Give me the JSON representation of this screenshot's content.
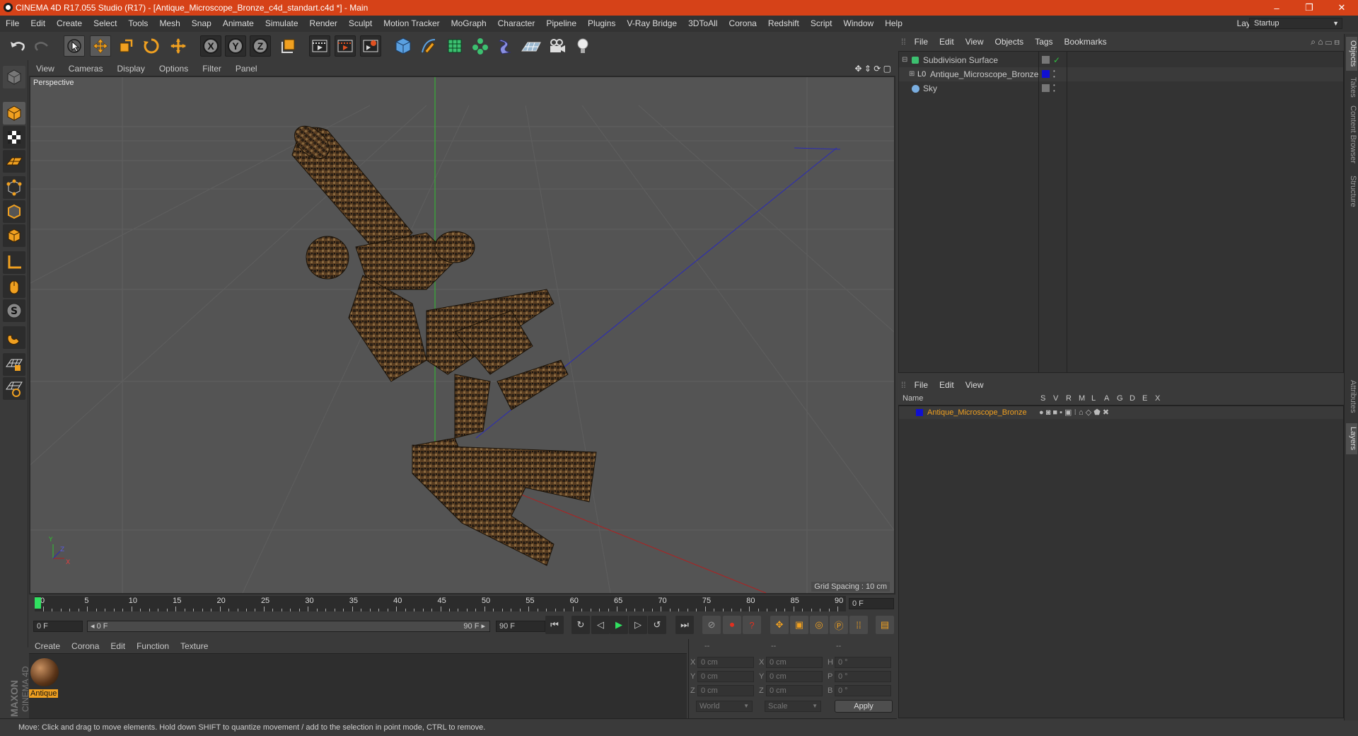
{
  "window": {
    "title": "CINEMA 4D R17.055 Studio (R17) - [Antique_Microscope_Bronze_c4d_standart.c4d *] - Main",
    "controls": [
      "–",
      "❐",
      "✕"
    ]
  },
  "menubar": {
    "items": [
      "File",
      "Edit",
      "Create",
      "Select",
      "Tools",
      "Mesh",
      "Snap",
      "Animate",
      "Simulate",
      "Render",
      "Sculpt",
      "Motion Tracker",
      "MoGraph",
      "Character",
      "Pipeline",
      "Plugins",
      "V-Ray Bridge",
      "3DToAll",
      "Corona",
      "Redshift",
      "Script",
      "Window",
      "Help"
    ],
    "layout_label": "Layout:",
    "layout_value": "Startup"
  },
  "toolbar": {
    "icons": [
      "undo-icon",
      "redo-icon",
      "select-icon",
      "move-icon",
      "scale-icon",
      "rotate-icon",
      "multi-move-icon",
      "x-axis-icon",
      "y-axis-icon",
      "z-axis-icon",
      "coordinate-system-icon",
      "render-view-icon",
      "render-picture-viewer-icon",
      "render-settings-icon",
      "cube-icon",
      "pen-icon",
      "subdivision-icon",
      "cloner-icon",
      "deformer-icon",
      "floor-icon",
      "camera-icon",
      "light-icon"
    ],
    "axis_labels": [
      "X",
      "Y",
      "Z"
    ]
  },
  "viewport": {
    "menu": [
      "View",
      "Cameras",
      "Display",
      "Options",
      "Filter",
      "Panel"
    ],
    "label": "Perspective",
    "grid_spacing": "Grid Spacing : 10 cm",
    "axis_labels": {
      "y": "Y",
      "z": "Z",
      "x": "X"
    }
  },
  "timeline": {
    "ticks": [
      "0",
      "5",
      "10",
      "15",
      "20",
      "25",
      "30",
      "35",
      "40",
      "45",
      "50",
      "55",
      "60",
      "65",
      "70",
      "75",
      "80",
      "85",
      "90"
    ],
    "current_frame": "0 F",
    "start_field": "0 F",
    "range_start": "◂ 0 F",
    "range_end": "90 F ▸",
    "end_field": "90 F"
  },
  "material_manager": {
    "menu": [
      "Create",
      "Corona",
      "Edit",
      "Function",
      "Texture"
    ],
    "materials": [
      {
        "name": "Antique"
      }
    ]
  },
  "coordinates": {
    "headers": [
      "--",
      "--",
      "--"
    ],
    "rows": [
      {
        "a": "X",
        "av": "0 cm",
        "b": "X",
        "bv": "0 cm",
        "c": "H",
        "cv": "0 °"
      },
      {
        "a": "Y",
        "av": "0 cm",
        "b": "Y",
        "bv": "0 cm",
        "c": "P",
        "cv": "0 °"
      },
      {
        "a": "Z",
        "av": "0 cm",
        "b": "Z",
        "bv": "0 cm",
        "c": "B",
        "cv": "0 °"
      }
    ],
    "mode": "World",
    "type": "Scale",
    "apply": "Apply"
  },
  "object_manager": {
    "menu": [
      "File",
      "Edit",
      "View",
      "Objects",
      "Tags",
      "Bookmarks"
    ],
    "objects": [
      {
        "name": "Subdivision Surface",
        "indent": 0,
        "color": "#c8c8c8"
      },
      {
        "name": "Antique_Microscope_Bronze",
        "indent": 1,
        "color": "#c8c8c8"
      },
      {
        "name": "Sky",
        "indent": 0,
        "color": "#c8c8c8"
      }
    ]
  },
  "layer_manager": {
    "menu": [
      "File",
      "Edit",
      "View"
    ],
    "headers": [
      "Name",
      "S",
      "V",
      "R",
      "M",
      "L",
      "A",
      "G",
      "D",
      "E",
      "X"
    ],
    "layers": [
      {
        "name": "Antique_Microscope_Bronze",
        "color": "#1010d0"
      }
    ]
  },
  "side_tabs": [
    "Objects",
    "Takes",
    "Content Browser",
    "Structure",
    "Attributes",
    "Layers"
  ],
  "brand": {
    "maxon": "MAXON",
    "c4d": "CINEMA 4D"
  },
  "status": "Move: Click and drag to move elements. Hold down SHIFT to quantize movement / add to the selection in point mode, CTRL to remove.",
  "colors": {
    "accent": "#d64218",
    "orange": "#f0a020",
    "layer_blue": "#1010d0"
  }
}
